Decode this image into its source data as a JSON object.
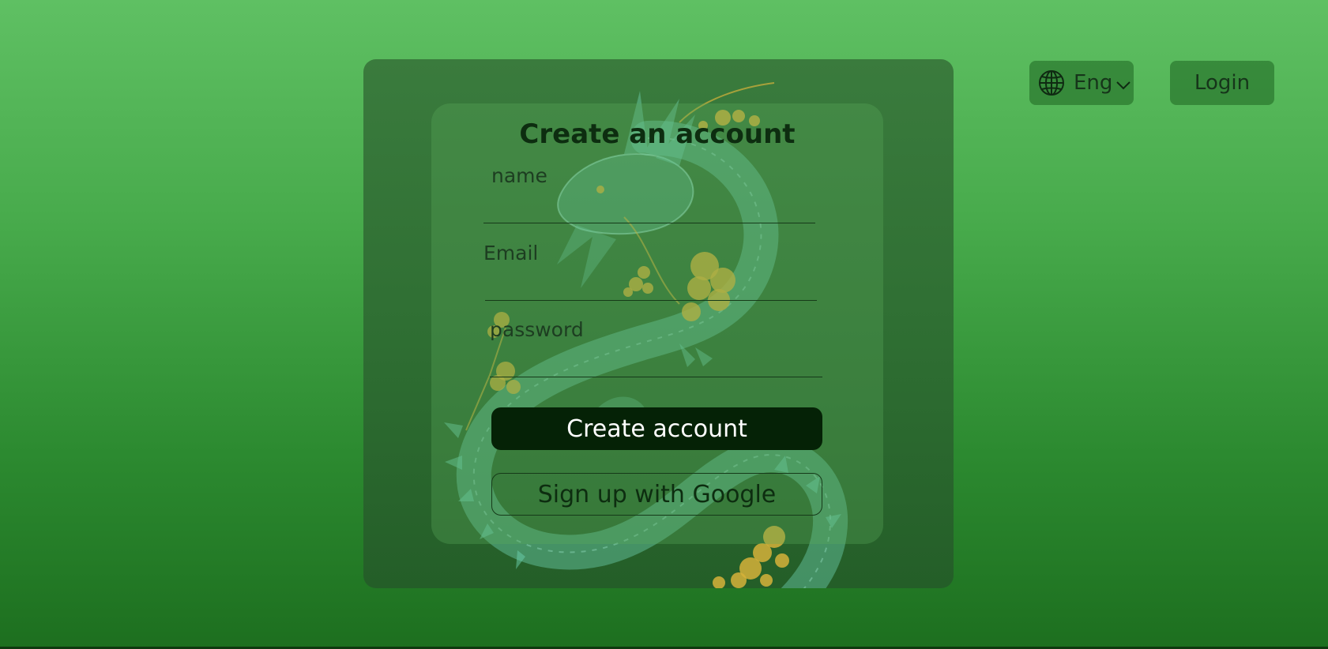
{
  "header": {
    "language": {
      "label": "Eng",
      "icon": "globe-icon",
      "chevron_icon": "chevron-down-icon"
    },
    "login_label": "Login"
  },
  "form": {
    "title": "Create an account",
    "fields": [
      {
        "label": "name",
        "value": ""
      },
      {
        "label": "Email",
        "value": ""
      },
      {
        "label": "password",
        "value": ""
      }
    ],
    "create_button_label": "Create account",
    "google_button_label": "Sign up with Google"
  },
  "colors": {
    "primary_button": "#052206",
    "text_dark": "#0d2d10",
    "blossom": "#d6b23a",
    "dragon": "#5fc4a0"
  }
}
